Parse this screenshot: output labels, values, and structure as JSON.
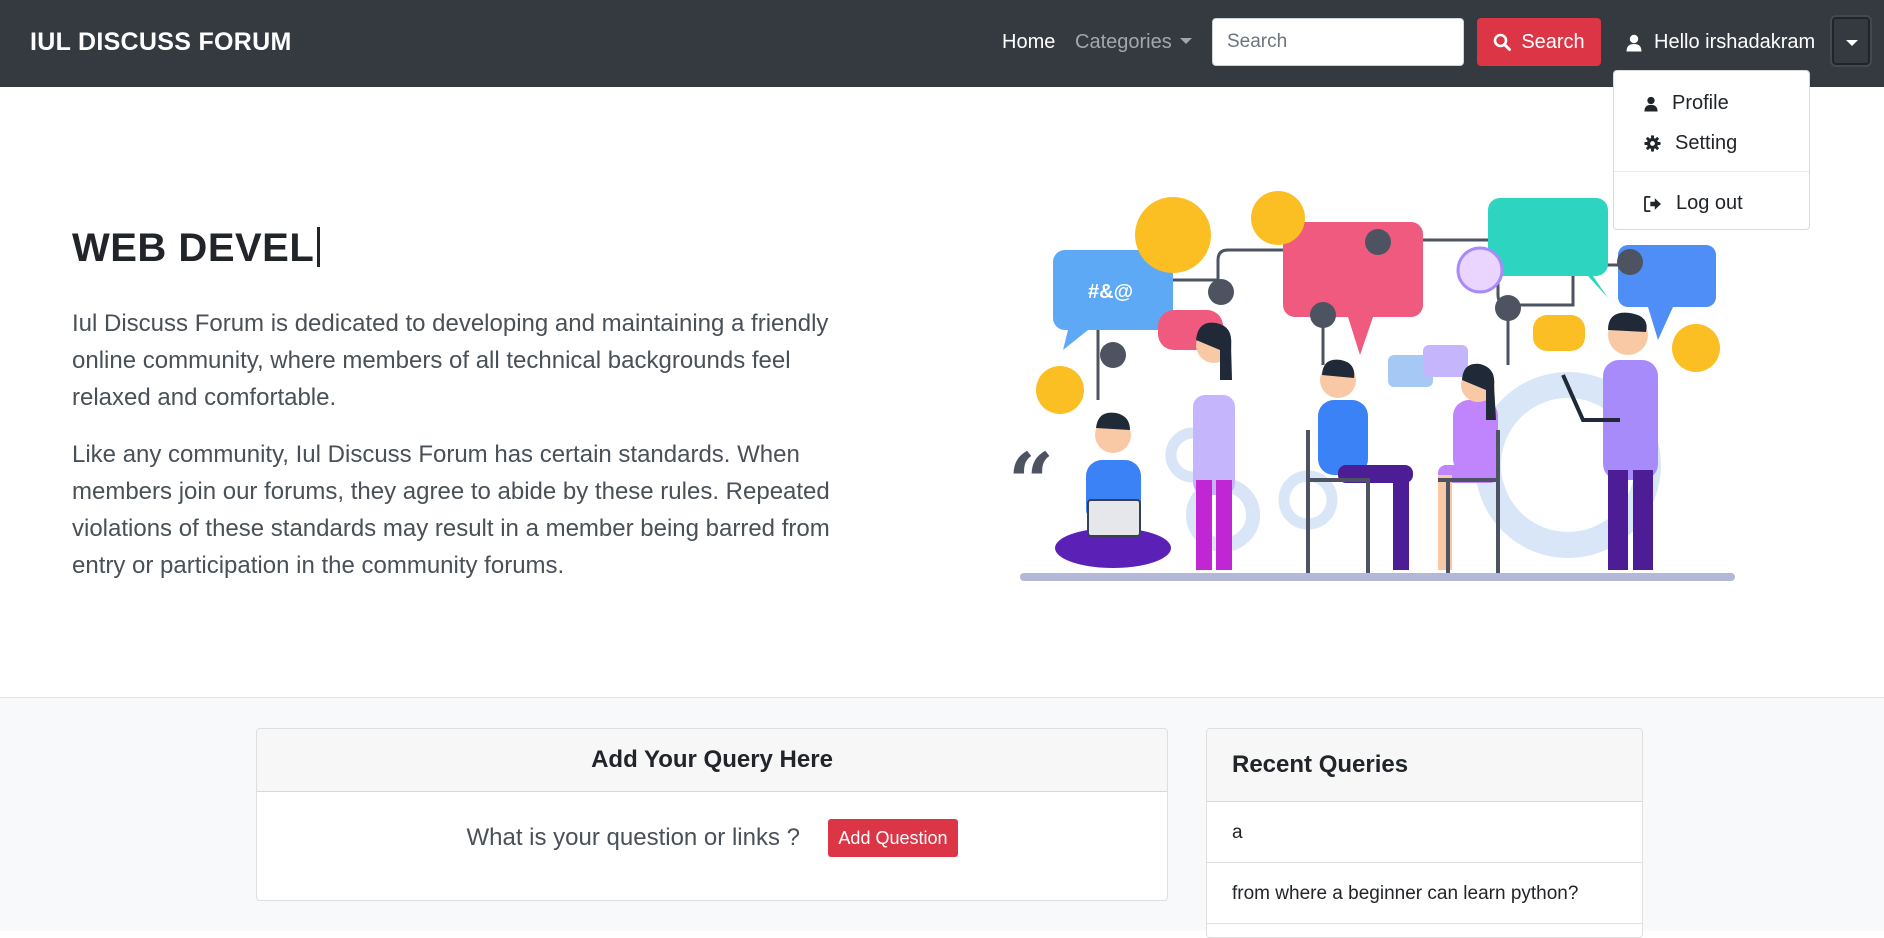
{
  "navbar": {
    "brand": "IUL DISCUSS FORUM",
    "home": "Home",
    "categories": "Categories",
    "search_placeholder": "Search",
    "search_button": "Search",
    "user_greeting": "Hello irshadakram"
  },
  "user_menu": {
    "items": [
      {
        "label": "Profile",
        "icon": "user-icon"
      },
      {
        "label": "Setting",
        "icon": "gear-icon"
      },
      {
        "label": "Log out",
        "icon": "sign-out-icon"
      }
    ]
  },
  "hero": {
    "title": "WEB DEVEL",
    "paragraph1": "Iul Discuss Forum is dedicated to developing and maintaining a friendly online community, where members of all technical backgrounds feel relaxed and comfortable.",
    "paragraph2": "Like any community, Iul Discuss Forum has certain standards. When members join our forums, they agree to abide by these rules. Repeated violations of these standards may result in a member being barred from entry or participation in the community forums."
  },
  "query_card": {
    "title": "Add Your Query Here",
    "prompt": "What is your question or links ?",
    "button": "Add Question"
  },
  "recent_card": {
    "title": "Recent Queries",
    "items": [
      "a",
      "from where a beginner can learn python?"
    ]
  },
  "colors": {
    "navbar": "#343a40",
    "accent_red": "#dc3545"
  }
}
